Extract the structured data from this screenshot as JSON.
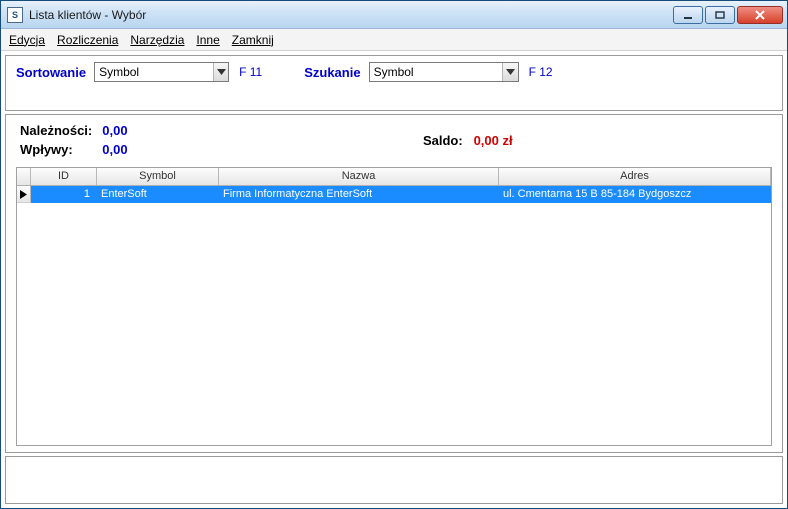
{
  "window": {
    "title": "Lista klientów  - Wybór"
  },
  "menu": {
    "edycja": "Edycja",
    "rozliczenia": "Rozliczenia",
    "narzedzia": "Narzędzia",
    "inne": "Inne",
    "zamknij": "Zamknij"
  },
  "filter": {
    "sort_label": "Sortowanie",
    "sort_value": "Symbol",
    "sort_hint": "F 11",
    "search_label": "Szukanie",
    "search_value": "Symbol",
    "search_hint": "F 12"
  },
  "summary": {
    "naleznosci_label": "Należności:",
    "naleznosci_value": "0,00",
    "wplywy_label": "Wpływy:",
    "wplywy_value": "0,00",
    "saldo_label": "Saldo:",
    "saldo_value": "0,00 zł"
  },
  "grid": {
    "columns": {
      "id": "ID",
      "symbol": "Symbol",
      "nazwa": "Nazwa",
      "adres": "Adres"
    },
    "rows": [
      {
        "id": "1",
        "symbol": "EnterSoft",
        "nazwa": "Firma Informatyczna EnterSoft",
        "adres": "ul. Cmentarna 15 B 85-184 Bydgoszcz"
      }
    ]
  }
}
